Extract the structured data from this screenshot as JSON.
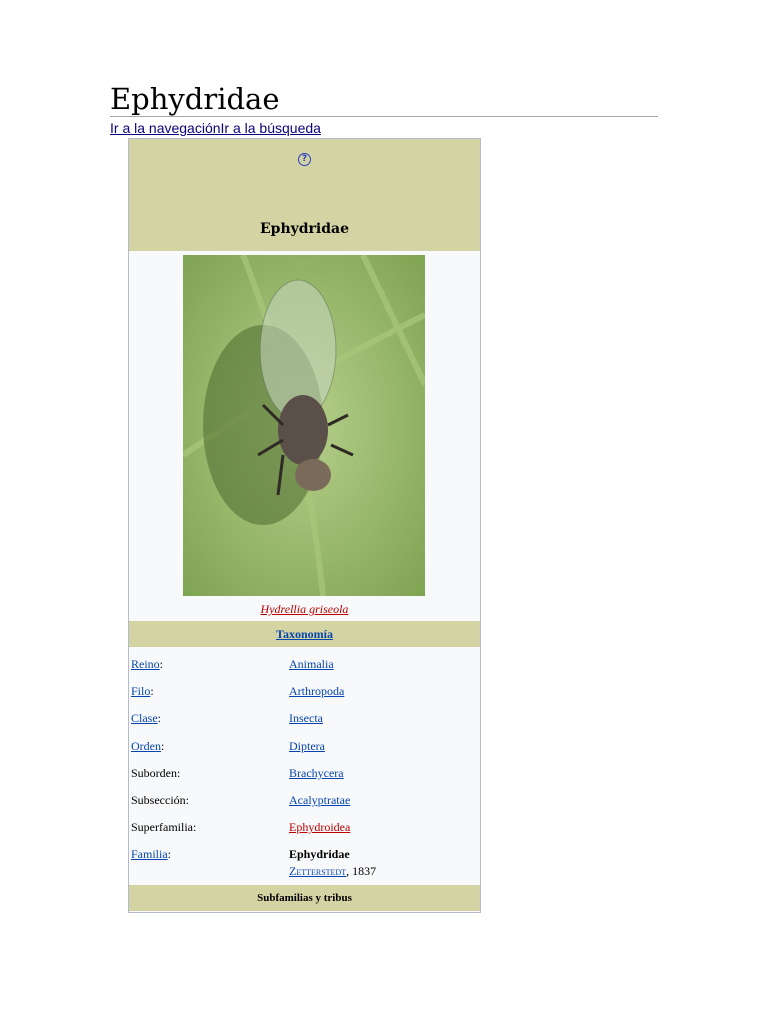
{
  "page_title": "Ephydridae",
  "skip_links": "Ir a la navegaciónIr a la búsqueda",
  "infobox": {
    "help_icon": "?",
    "title": "Ephydridae",
    "image_caption": "Hydrellia griseola",
    "taxonomy_header": "Taxonomía",
    "rows": [
      {
        "label": "Reino",
        "value": "Animalia",
        "label_link": true,
        "value_style": "link"
      },
      {
        "label": "Filo",
        "value": "Arthropoda",
        "label_link": true,
        "value_style": "link"
      },
      {
        "label": "Clase",
        "value": "Insecta",
        "label_link": true,
        "value_style": "link"
      },
      {
        "label": "Orden",
        "value": "Diptera",
        "label_link": true,
        "value_style": "link"
      },
      {
        "label": "Suborden",
        "value": "Brachycera",
        "label_link": false,
        "value_style": "link"
      },
      {
        "label": "Subsección",
        "value": "Acalyptratae",
        "label_link": false,
        "value_style": "link"
      },
      {
        "label": "Superfamilia",
        "value": "Ephydroidea",
        "label_link": false,
        "value_style": "red"
      },
      {
        "label": "Familia",
        "value": "Ephydridae",
        "label_link": true,
        "value_style": "bold"
      }
    ],
    "author": "Zetterstedt",
    "author_year": ", 1837",
    "subfamilies_header": "Subfamilias y tribus"
  }
}
